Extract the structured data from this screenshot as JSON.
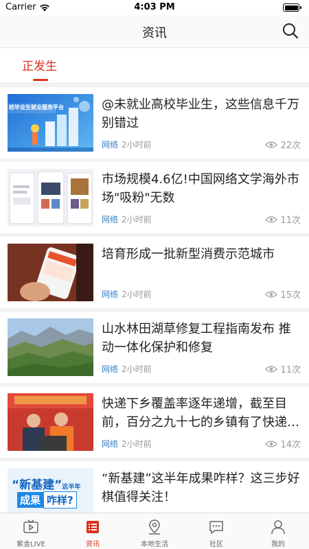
{
  "status_bar": {
    "carrier": "Carrier",
    "time": "4:03 PM"
  },
  "nav": {
    "title": "资讯",
    "search_icon": "search-icon"
  },
  "channel": {
    "active_tab": "正发生",
    "accent_color": "#d9321c"
  },
  "news": [
    {
      "title": "@未就业高校毕业生，这些信息千万别错过",
      "source": "网络",
      "time": "2小时前",
      "views": "22次",
      "thumb_caption": "校毕业生就业服务平台"
    },
    {
      "title": "市场规模4.6亿!中国网络文学海外市场\"吸粉\"无数",
      "source": "网络",
      "time": "2小时前",
      "views": "11次"
    },
    {
      "title": "培育形成一批新型消费示范城市",
      "source": "网络",
      "time": "2小时前",
      "views": "15次"
    },
    {
      "title": "山水林田湖草修复工程指南发布 推动一体化保护和修复",
      "source": "网络",
      "time": "2小时前",
      "views": "11次"
    },
    {
      "title": "快递下乡覆盖率逐年递增，截至目前，百分之九十七的乡镇有了快递网点",
      "source": "网络",
      "time": "2小时前",
      "views": "14次"
    },
    {
      "title": "“新基建”这半年成果咋样？这三步好棋值得关注！",
      "source": "",
      "time": "",
      "views": "",
      "thumb_line1": "“新基建”",
      "thumb_line1_small": "这半年",
      "thumb_line2a": "成果",
      "thumb_line2b": "咋样?"
    }
  ],
  "tabs": [
    {
      "label": "紫金LIVE",
      "icon": "tv-play-icon"
    },
    {
      "label": "资讯",
      "icon": "news-list-icon",
      "active": true
    },
    {
      "label": "本地生活",
      "icon": "map-pin-icon"
    },
    {
      "label": "社区",
      "icon": "chat-bubble-icon"
    },
    {
      "label": "我的",
      "icon": "user-icon"
    }
  ]
}
